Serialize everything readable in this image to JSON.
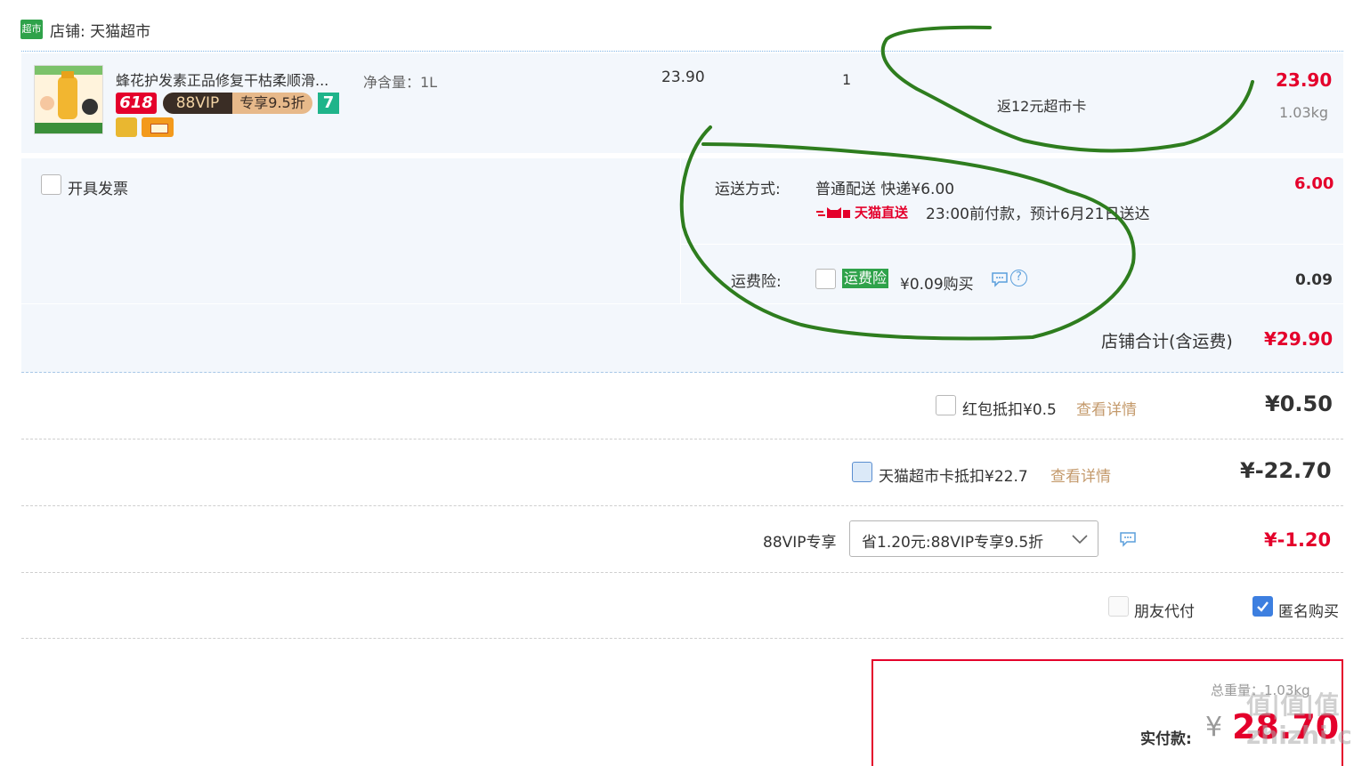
{
  "shop": {
    "badge": "超市",
    "label": "店铺: 天猫超市"
  },
  "item": {
    "title": "蜂花护发素正品修复干枯柔顺滑...",
    "spec": "净含量：1L",
    "price": "23.90",
    "qty": "1",
    "promo": "返12元超市卡",
    "subtotal": "23.90",
    "weight": "1.03kg",
    "tags": {
      "t618": "618",
      "vip": "88VIP",
      "vip_discount": "专享9.5折",
      "seven": "7"
    }
  },
  "invoice": {
    "label": "开具发票"
  },
  "shipping": {
    "label": "运送方式:",
    "method": "普通配送 快递¥6.00",
    "direct_label": "天猫直送",
    "eta": "23:00前付款，预计6月21日送达",
    "fee": "6.00"
  },
  "insurance": {
    "label": "运费险:",
    "badge": "运费险",
    "text": "¥0.09购买",
    "fee": "0.09"
  },
  "shop_total": {
    "label": "店铺合计(含运费)",
    "value": "¥29.90"
  },
  "redpacket": {
    "label": "红包抵扣¥0.5",
    "link": "查看详情",
    "value": "¥0.50"
  },
  "card": {
    "label": "天猫超市卡抵扣¥22.7",
    "link": "查看详情",
    "value": "¥-22.70"
  },
  "vip": {
    "label": "88VIP专享",
    "selected": "省1.20元:88VIP专享9.5折",
    "value": "¥-1.20"
  },
  "options": {
    "friend_pay": "朋友代付",
    "anonymous": "匿名购买"
  },
  "summary": {
    "weight_label": "总重量：1.03kg",
    "pay_label": "实付款:",
    "currency": "¥",
    "pay_value": "28.70"
  },
  "watermark": "值|值|值 zhizhi.com",
  "colors": {
    "accent_red": "#e4002b",
    "annotation_green": "#2e7d1e",
    "tmall_green": "#2fa24a",
    "link_brown": "#c49a6c"
  }
}
